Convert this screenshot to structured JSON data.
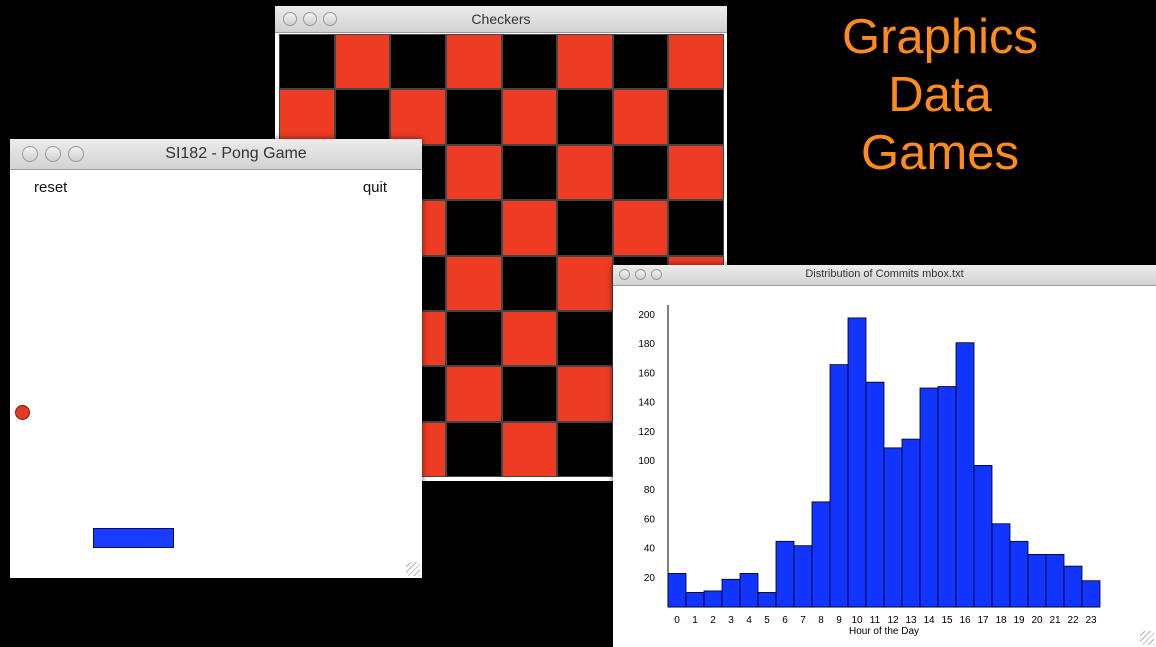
{
  "headline": {
    "lines": [
      "Graphics",
      "Data",
      "Games"
    ],
    "color": "#ff8c1a"
  },
  "checkers_window": {
    "title": "Checkers",
    "colors": {
      "red": "#ee3b24",
      "black": "#000000"
    }
  },
  "pong_window": {
    "title": "SI182 - Pong Game",
    "reset_label": "reset",
    "quit_label": "quit",
    "ball_color": "#e23b22",
    "paddle_color": "#1a3cff"
  },
  "chart_window": {
    "title": "Distribution of Commits mbox.txt"
  },
  "chart_data": {
    "type": "bar",
    "title": "",
    "xlabel": "Hour of the Day",
    "ylabel": "",
    "ylim": [
      0,
      200
    ],
    "yticks": [
      20,
      40,
      60,
      80,
      100,
      120,
      140,
      160,
      180,
      200
    ],
    "categories": [
      "0",
      "1",
      "2",
      "3",
      "4",
      "5",
      "6",
      "7",
      "8",
      "9",
      "10",
      "11",
      "12",
      "13",
      "14",
      "15",
      "16",
      "17",
      "18",
      "19",
      "20",
      "21",
      "22",
      "23"
    ],
    "values": [
      23,
      10,
      11,
      19,
      23,
      10,
      45,
      42,
      72,
      166,
      198,
      154,
      109,
      115,
      150,
      151,
      181,
      97,
      57,
      45,
      36,
      36,
      28,
      18
    ],
    "bar_color": "#1234ff",
    "grid": false,
    "legend": "none"
  }
}
